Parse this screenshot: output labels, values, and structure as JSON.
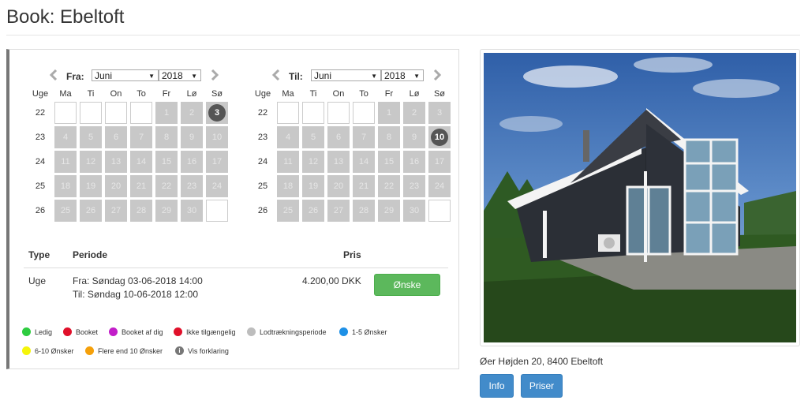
{
  "page": {
    "title": "Book: Ebeltoft"
  },
  "calendars": [
    {
      "label": "Fra:",
      "month": "Juni",
      "year": "2018",
      "day_headers": [
        "Uge",
        "Ma",
        "Ti",
        "On",
        "To",
        "Fr",
        "Lø",
        "Sø"
      ],
      "weeks": [
        {
          "wk": "22",
          "days": [
            "",
            "",
            "",
            "",
            "1",
            "2",
            "3"
          ]
        },
        {
          "wk": "23",
          "days": [
            "4",
            "5",
            "6",
            "7",
            "8",
            "9",
            "10"
          ]
        },
        {
          "wk": "24",
          "days": [
            "11",
            "12",
            "13",
            "14",
            "15",
            "16",
            "17"
          ]
        },
        {
          "wk": "25",
          "days": [
            "18",
            "19",
            "20",
            "21",
            "22",
            "23",
            "24"
          ]
        },
        {
          "wk": "26",
          "days": [
            "25",
            "26",
            "27",
            "28",
            "29",
            "30",
            ""
          ]
        }
      ],
      "selected_day": "3"
    },
    {
      "label": "Til:",
      "month": "Juni",
      "year": "2018",
      "day_headers": [
        "Uge",
        "Ma",
        "Ti",
        "On",
        "To",
        "Fr",
        "Lø",
        "Sø"
      ],
      "weeks": [
        {
          "wk": "22",
          "days": [
            "",
            "",
            "",
            "",
            "1",
            "2",
            "3"
          ]
        },
        {
          "wk": "23",
          "days": [
            "4",
            "5",
            "6",
            "7",
            "8",
            "9",
            "10"
          ]
        },
        {
          "wk": "24",
          "days": [
            "11",
            "12",
            "13",
            "14",
            "15",
            "16",
            "17"
          ]
        },
        {
          "wk": "25",
          "days": [
            "18",
            "19",
            "20",
            "21",
            "22",
            "23",
            "24"
          ]
        },
        {
          "wk": "26",
          "days": [
            "25",
            "26",
            "27",
            "28",
            "29",
            "30",
            ""
          ]
        }
      ],
      "selected_day": "10"
    }
  ],
  "booking_table": {
    "headers": {
      "type": "Type",
      "periode": "Periode",
      "pris": "Pris"
    },
    "row": {
      "type": "Uge",
      "fra": "Fra: Søndag 03-06-2018 14:00",
      "til": "Til: Søndag 10-06-2018 12:00",
      "pris": "4.200,00 DKK",
      "button": "Ønske"
    }
  },
  "legend": [
    {
      "label": "Ledig",
      "color": "#2ecc40"
    },
    {
      "label": "Booket",
      "color": "#e0102a"
    },
    {
      "label": "Booket af dig",
      "color": "#c21ec9"
    },
    {
      "label": "Ikke tilgængelig",
      "color": "#e0102a"
    },
    {
      "label": "Lodtrækningsperiode",
      "color": "#bdbdbd"
    },
    {
      "label": "1-5 Ønsker",
      "color": "#1e90e6"
    },
    {
      "label": "6-10 Ønsker",
      "color": "#f5f50a"
    },
    {
      "label": "Flere end 10 Ønsker",
      "color": "#f5a00a"
    },
    {
      "label": "Vis forklaring",
      "color": "#777777",
      "icon": "info-icon"
    }
  ],
  "property": {
    "address": "Øer Højden 20, 8400 Ebeltoft",
    "buttons": {
      "info": "Info",
      "priser": "Priser"
    }
  },
  "colors": {
    "primary": "#428bca",
    "success": "#5cb85c",
    "selected_day": "#555555",
    "unavailable": "#c8c8c8"
  }
}
